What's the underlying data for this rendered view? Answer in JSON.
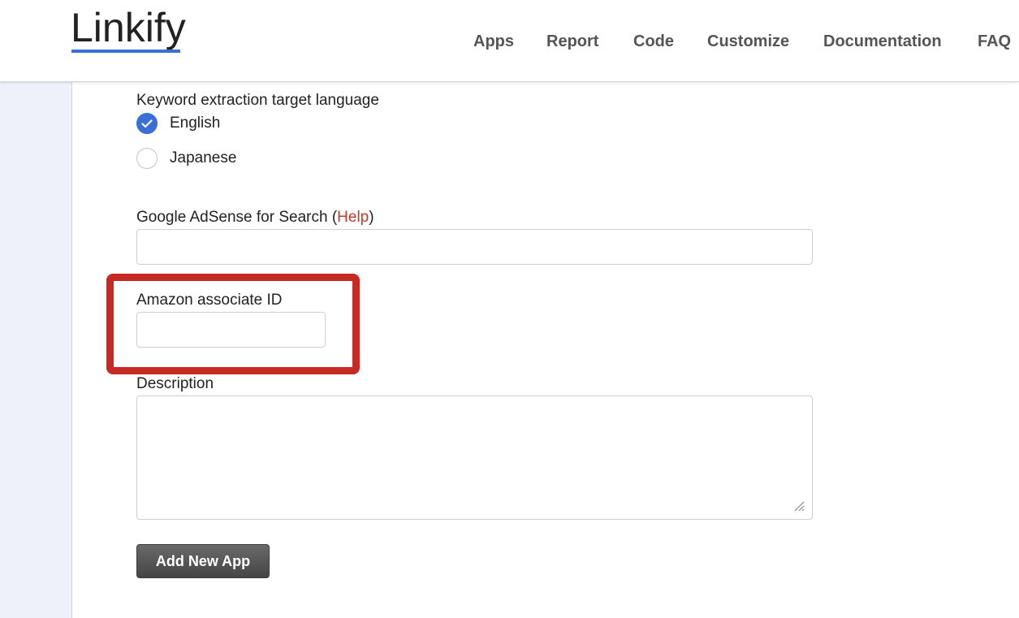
{
  "header": {
    "logo": "Linkify",
    "nav": [
      "Apps",
      "Report",
      "Code",
      "Customize",
      "Documentation",
      "FAQ"
    ]
  },
  "form": {
    "language": {
      "label": "Keyword extraction target language",
      "options": [
        {
          "label": "English",
          "checked": true
        },
        {
          "label": "Japanese",
          "checked": false
        }
      ]
    },
    "adsense": {
      "label_prefix": "Google AdSense for Search (",
      "help_link": "Help",
      "label_suffix": ")",
      "value": ""
    },
    "amazon": {
      "label": "Amazon associate ID",
      "value": "",
      "highlight_color": "#c62a22"
    },
    "description": {
      "label": "Description",
      "value": ""
    },
    "submit_label": "Add New App"
  },
  "colors": {
    "accent": "#3a6fd8",
    "link": "#c0392b",
    "sidebar": "#eef1f9"
  }
}
